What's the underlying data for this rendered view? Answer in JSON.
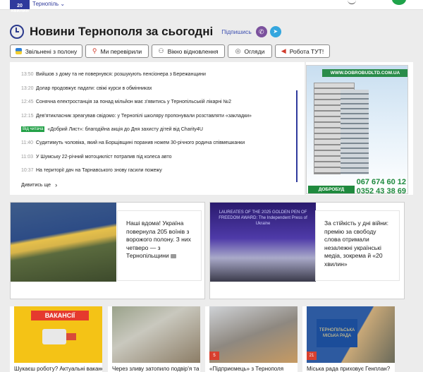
{
  "header": {
    "logo_text": "20 хвилин",
    "city": "Тернопіль ⌄"
  },
  "title_row": {
    "title": "Новини Тернополя за сьогодні",
    "subscribe": "Підпишись",
    "icons": [
      "viber-icon",
      "telegram-icon"
    ]
  },
  "tags": [
    {
      "label": "Звільнені з полону",
      "icon": "flag-icon"
    },
    {
      "label": "Ми перевірили",
      "icon": "magnifier-icon"
    },
    {
      "label": "Вікно відновлення",
      "icon": "person-icon"
    },
    {
      "label": "Огляди",
      "icon": "eye-icon"
    },
    {
      "label": "Робота ТУТ!",
      "icon": "megaphone-icon"
    }
  ],
  "news": [
    {
      "time": "13:50",
      "text": "Вийшов з дому та не повернувся: розшукують пенсіонера з Бережанщини"
    },
    {
      "time": "13:20",
      "text": "Долар продовжує падати: свіжі курси в обмінниках"
    },
    {
      "time": "12:45",
      "text": "Сонячна електростанція за понад мільйон має з'явитись у Тернопільській лікарні №2"
    },
    {
      "time": "12:15",
      "text": "Дев'ятикласник зреагував свідомо: у Тернопілі школяру пропонували розставляти «закладки»"
    },
    {
      "badge": "Від читача",
      "text": "«Добрий Лист»: благодійна акція до Дня захисту дітей від Charity4U"
    },
    {
      "time": "11:40",
      "text": "Судитимуть чоловіка, який на Борщівщині поранив ножем 30-річного родича співмешканки"
    },
    {
      "time": "11:03",
      "text": "У Шумську 22-річний мотоцикліст потрапив під колеса авто"
    },
    {
      "time": "10:37",
      "text": "На території дач на Тарнавського знову гасили пожежу"
    }
  ],
  "see_more": "Дивитись ще",
  "ad": {
    "url": "WWW.DOBROBUDLTD.COM.UA",
    "phone1": "067 674 60 12",
    "phone2": "0352 43 38 69",
    "brand": "ДОБРОБУД"
  },
  "features": [
    {
      "text": "Наші вдома! Україна повернула 205 воїнів з ворожого полону. З них четверо — з Тернопільщини"
    },
    {
      "text": "За стійкість у дні війни: премію за свободу слова отримали незалежні українські медіа, зокрема й «20 хвилин»",
      "image_text": "LAUREATES OF THE 2025 GOLDEN PEN OF FREEDOM AWARD: The Independent Press of Ukraine"
    }
  ],
  "cards": [
    {
      "title": "Шукаєш роботу? Актуальні вакансії,",
      "image_text": "ВАКАНСІЇ"
    },
    {
      "title": "Через зливу затопило подвір'я та"
    },
    {
      "title": "«Підприємець» з Тернополя",
      "badge": "5"
    },
    {
      "title": "Міська рада приховує Генплан?",
      "badge": "21",
      "image_text": "ТЕРНОПІЛЬСЬКА МІСЬКА РАДА"
    },
    {
      "title": ""
    }
  ]
}
